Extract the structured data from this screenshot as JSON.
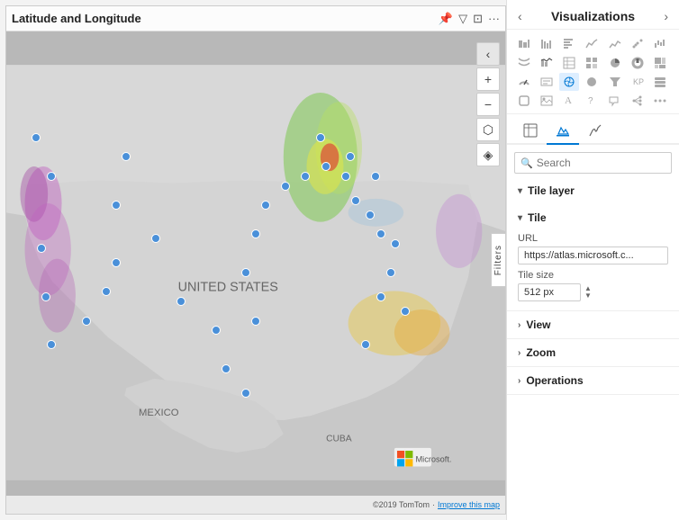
{
  "map": {
    "title": "Latitude and Longitude",
    "footer": "©2019 TomTom",
    "improve_link": "Improve this map",
    "controls": {
      "back": "‹",
      "zoom_in": "+",
      "zoom_out": "−",
      "layers": "⬡",
      "compass": "◈"
    },
    "data_points": [
      {
        "top": "22%",
        "left": "6%"
      },
      {
        "top": "30%",
        "left": "9%"
      },
      {
        "top": "45%",
        "left": "7%"
      },
      {
        "top": "55%",
        "left": "8%"
      },
      {
        "top": "65%",
        "left": "9%"
      },
      {
        "top": "60%",
        "left": "16%"
      },
      {
        "top": "54%",
        "left": "20%"
      },
      {
        "top": "48%",
        "left": "22%"
      },
      {
        "top": "36%",
        "left": "22%"
      },
      {
        "top": "26%",
        "left": "24%"
      },
      {
        "top": "43%",
        "left": "30%"
      },
      {
        "top": "56%",
        "left": "35%"
      },
      {
        "top": "62%",
        "left": "42%"
      },
      {
        "top": "70%",
        "left": "44%"
      },
      {
        "top": "60%",
        "left": "50%"
      },
      {
        "top": "50%",
        "left": "48%"
      },
      {
        "top": "42%",
        "left": "50%"
      },
      {
        "top": "36%",
        "left": "52%"
      },
      {
        "top": "32%",
        "left": "56%"
      },
      {
        "top": "30%",
        "left": "60%"
      },
      {
        "top": "28%",
        "left": "64%"
      },
      {
        "top": "30%",
        "left": "68%"
      },
      {
        "top": "35%",
        "left": "70%"
      },
      {
        "top": "38%",
        "left": "73%"
      },
      {
        "top": "42%",
        "left": "75%"
      },
      {
        "top": "44%",
        "left": "78%"
      },
      {
        "top": "50%",
        "left": "77%"
      },
      {
        "top": "55%",
        "left": "75%"
      },
      {
        "top": "58%",
        "left": "80%"
      },
      {
        "top": "65%",
        "left": "72%"
      },
      {
        "top": "75%",
        "left": "48%"
      },
      {
        "top": "30%",
        "left": "74%"
      },
      {
        "top": "26%",
        "left": "69%"
      },
      {
        "top": "22%",
        "left": "63%"
      }
    ]
  },
  "filters_tab": {
    "label": "Filters"
  },
  "viz_panel": {
    "title": "Visualizations",
    "left_arrow": "‹",
    "right_arrow": "›",
    "search": {
      "placeholder": "Search",
      "value": ""
    },
    "tabs": [
      {
        "id": "fields",
        "icon": "⊞",
        "label": "Fields"
      },
      {
        "id": "format",
        "icon": "🖌",
        "label": "Format",
        "active": true
      },
      {
        "id": "analytics",
        "icon": "☞",
        "label": "Analytics"
      }
    ],
    "sections": {
      "tile_layer": {
        "label": "Tile layer",
        "expanded": true,
        "sub_sections": {
          "tile": {
            "label": "Tile",
            "expanded": true,
            "url_label": "URL",
            "url_value": "https://atlas.microsoft.c...",
            "tile_size_label": "Tile size",
            "tile_size_value": "512 px"
          }
        }
      },
      "view": {
        "label": "View",
        "expanded": false
      },
      "zoom": {
        "label": "Zoom",
        "expanded": false
      },
      "operations": {
        "label": "Operations",
        "expanded": false
      }
    }
  }
}
